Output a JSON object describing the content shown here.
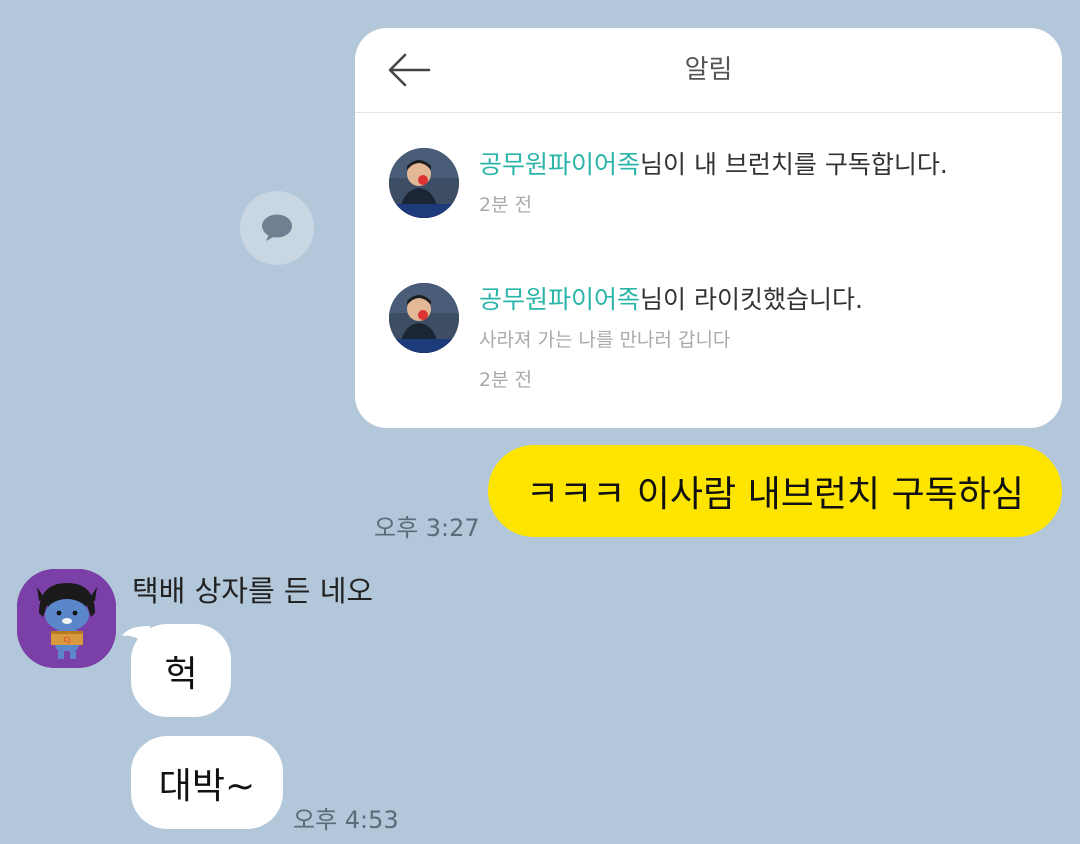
{
  "share_button": {
    "icon": "speech-bubble-icon"
  },
  "notification_card": {
    "back_icon": "arrow-left-icon",
    "title": "알림",
    "items": [
      {
        "name": "공무원파이어족",
        "text": "님이 내 브런치를 구독합니다.",
        "subtitle": "",
        "time": "2분 전"
      },
      {
        "name": "공무원파이어족",
        "text": "님이 라이킷했습니다.",
        "subtitle": "사라져 가는 나를 만나러 갑니다",
        "time": "2분 전"
      }
    ]
  },
  "my_message": {
    "text": "ㅋㅋㅋ 이사람 내브런치 구독하심",
    "time": "오후 3:27"
  },
  "friend": {
    "name": "택배 상자를 든 네오",
    "messages": [
      "헉",
      "대박~"
    ],
    "time": "오후 4:53"
  },
  "colors": {
    "background": "#b2c7d9",
    "my_bubble": "#fee500",
    "friend_bubble": "#ffffff",
    "name_accent": "#2bb5a8"
  }
}
